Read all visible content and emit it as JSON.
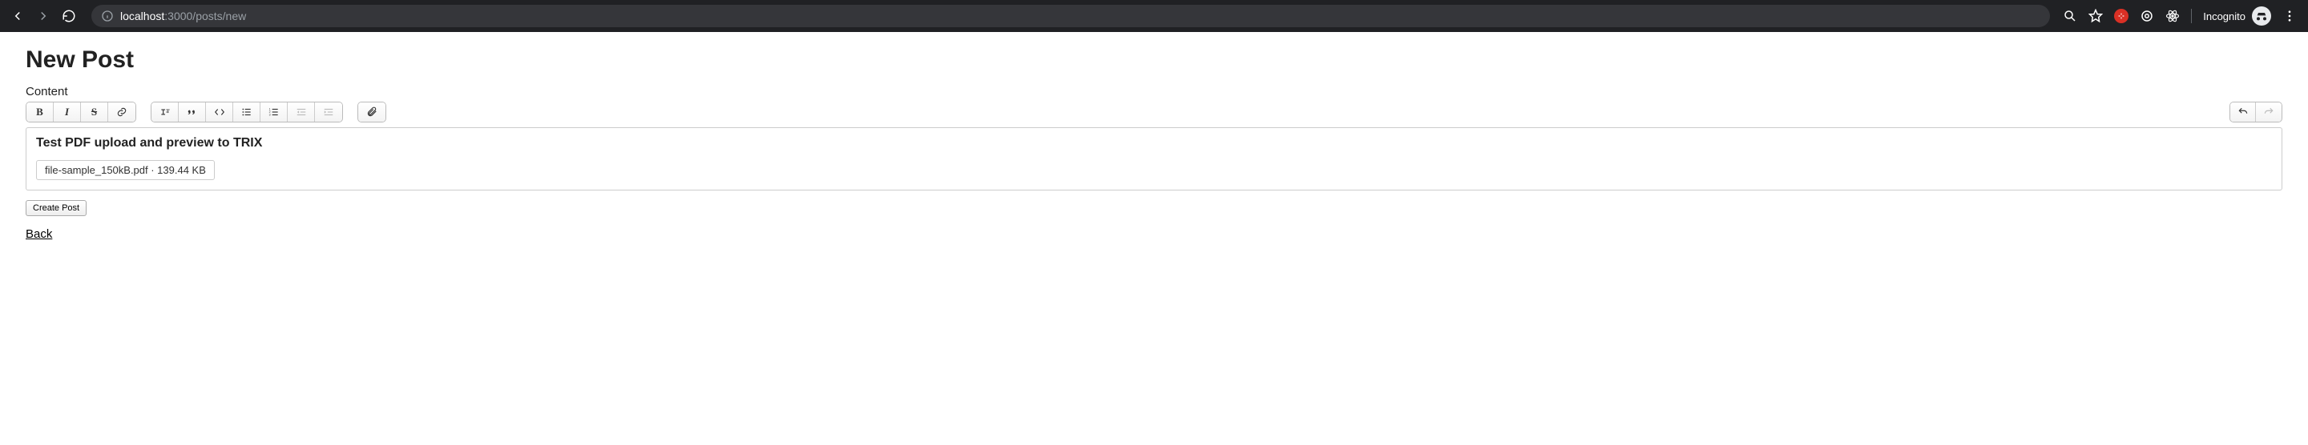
{
  "browser": {
    "url_host": "localhost",
    "url_port_path": ":3000/posts/new",
    "incognito_label": "Incognito"
  },
  "page": {
    "title": "New Post",
    "content_label": "Content",
    "editor_heading": "Test PDF upload and preview to TRIX",
    "attachment_text": "file-sample_150kB.pdf · 139.44 KB",
    "submit_label": "Create Post",
    "back_label": "Back"
  },
  "toolbar": {
    "bold": "B",
    "italic": "I",
    "strike": "S",
    "quote": "❝❞"
  }
}
